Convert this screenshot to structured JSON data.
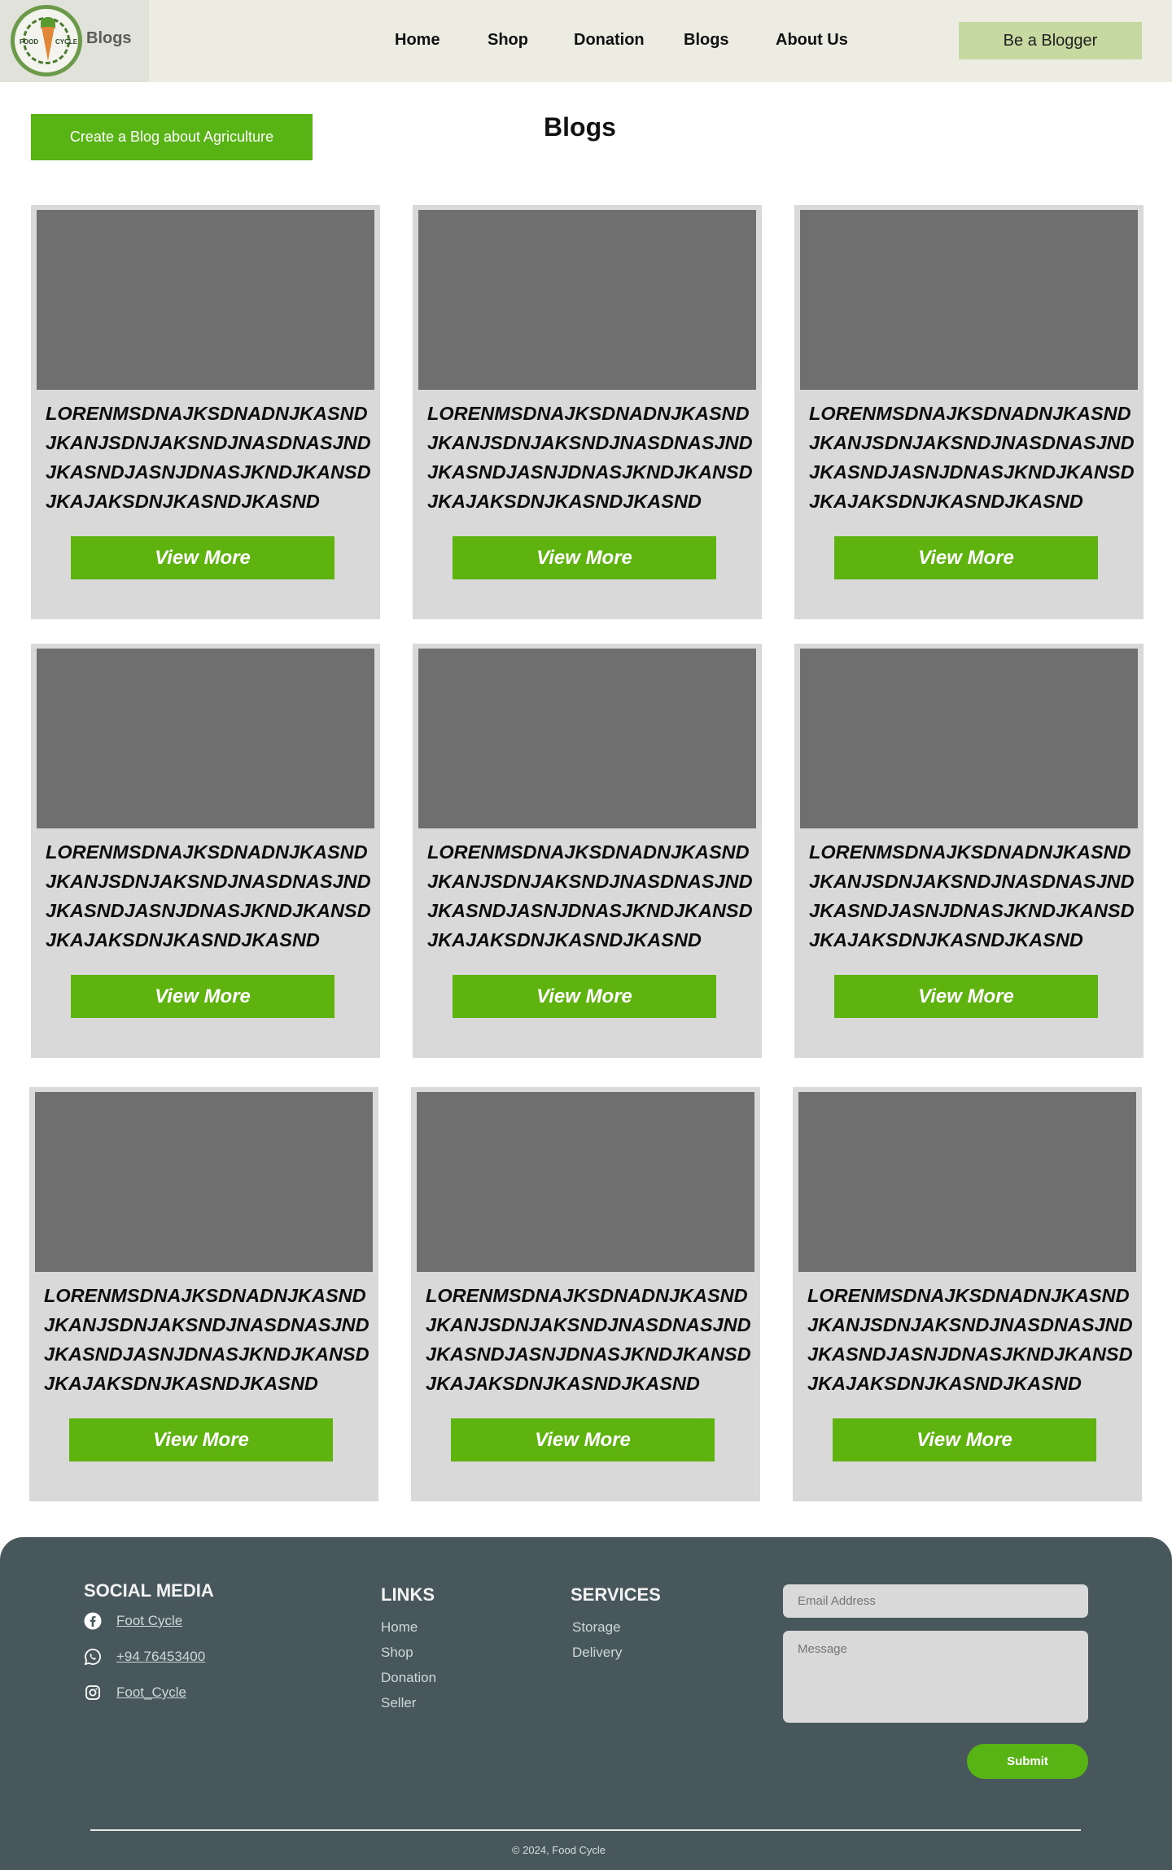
{
  "header": {
    "logo_text_left": "FOOD",
    "logo_text_right": "CYCLE",
    "brand": "Blogs",
    "nav": [
      "Home",
      "Shop",
      "Donation",
      "Blogs",
      "About Us"
    ],
    "cta": "Be a Blogger"
  },
  "main": {
    "create_button": "Create a Blog about Agriculture",
    "title": "Blogs",
    "cards": [
      {
        "text": "LORENMSDNAJKSDNADNJKASNDJKANJSDNJAKSNDJNASDNASJNDJKASNDJASNJDNASJKNDJKANSDJKAJAKSDNJKASNDJKASND",
        "button": "View More"
      },
      {
        "text": "LORENMSDNAJKSDNADNJKASNDJKANJSDNJAKSNDJNASDNASJNDJKASNDJASNJDNASJKNDJKANSDJKAJAKSDNJKASNDJKASND",
        "button": "View More"
      },
      {
        "text": "LORENMSDNAJKSDNADNJKASNDJKANJSDNJAKSNDJNASDNASJNDJKASNDJASNJDNASJKNDJKANSDJKAJAKSDNJKASNDJKASND",
        "button": "View More"
      },
      {
        "text": "LORENMSDNAJKSDNADNJKASNDJKANJSDNJAKSNDJNASDNASJNDJKASNDJASNJDNASJKNDJKANSDJKAJAKSDNJKASNDJKASND",
        "button": "View More"
      },
      {
        "text": "LORENMSDNAJKSDNADNJKASNDJKANJSDNJAKSNDJNASDNASJNDJKASNDJASNJDNASJKNDJKANSDJKAJAKSDNJKASNDJKASND",
        "button": "View More"
      },
      {
        "text": "LORENMSDNAJKSDNADNJKASNDJKANJSDNJAKSNDJNASDNASJNDJKASNDJASNJDNASJKNDJKANSDJKAJAKSDNJKASNDJKASND",
        "button": "View More"
      },
      {
        "text": "LORENMSDNAJKSDNADNJKASNDJKANJSDNJAKSNDJNASDNASJNDJKASNDJASNJDNASJKNDJKANSDJKAJAKSDNJKASNDJKASND",
        "button": "View More"
      },
      {
        "text": "LORENMSDNAJKSDNADNJKASNDJKANJSDNJAKSNDJNASDNASJNDJKASNDJASNJDNASJKNDJKANSDJKAJAKSDNJKASNDJKASND",
        "button": "View More"
      },
      {
        "text": "LORENMSDNAJKSDNADNJKASNDJKANJSDNJAKSNDJNASDNASJNDJKASNDJASNJDNASJKNDJKANSDJKAJAKSDNJKASNDJKASND",
        "button": "View More"
      }
    ]
  },
  "footer": {
    "social_title": "SOCIAL MEDIA",
    "social": [
      {
        "icon": "facebook-icon",
        "label": "Foot Cycle"
      },
      {
        "icon": "whatsapp-icon",
        "label": "+94 76453400"
      },
      {
        "icon": "instagram-icon",
        "label": "Foot_Cycle"
      }
    ],
    "links_title": "LINKS",
    "links": [
      "Home",
      "Shop",
      "Donation",
      "Seller"
    ],
    "services_title": "SERVICES",
    "services": [
      "Storage",
      "Delivery"
    ],
    "email_placeholder": "Email Address",
    "message_placeholder": "Message",
    "submit": "Submit",
    "copyright": "© 2024, Food Cycle"
  },
  "colors": {
    "header_bg": "#ecece3",
    "cta_bg": "#c5d9a0",
    "accent_green": "#5fb30f",
    "card_bg": "#d9d9d9",
    "image_placeholder": "#6f6f6f",
    "footer_bg": "#48575b"
  }
}
